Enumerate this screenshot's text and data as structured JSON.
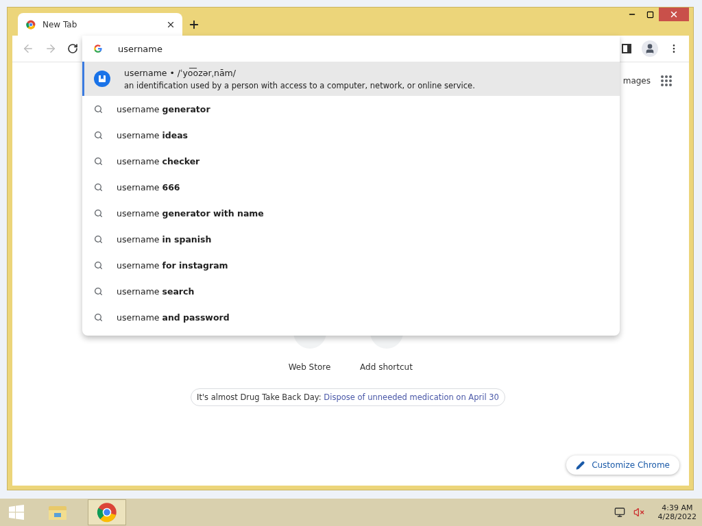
{
  "tabs": [
    {
      "title": "New Tab",
      "selected": true
    }
  ],
  "omnibox": {
    "value": "username"
  },
  "suggestions": [
    {
      "kind": "definition",
      "title": "username • /ˈyo͞ozərˌnām/",
      "description": "an identification used by a person with access to a computer, network, or online service.",
      "selected": true
    },
    {
      "kind": "search",
      "text": "username **generator**",
      "selected": false
    },
    {
      "kind": "search",
      "text": "username **ideas**",
      "selected": false
    },
    {
      "kind": "search",
      "text": "username **checker**",
      "selected": false
    },
    {
      "kind": "search",
      "text": "username **666**",
      "selected": false
    },
    {
      "kind": "search",
      "text": "username **generator with name**",
      "selected": false
    },
    {
      "kind": "search",
      "text": "username **in spanish**",
      "selected": false
    },
    {
      "kind": "search",
      "text": "username **for instagram**",
      "selected": false
    },
    {
      "kind": "search",
      "text": "username **search**",
      "selected": false
    },
    {
      "kind": "search",
      "text": "username **and password**",
      "selected": false
    }
  ],
  "page": {
    "images_link": "mages",
    "shortcuts": [
      {
        "label": "Web Store"
      },
      {
        "label": "Add shortcut"
      }
    ],
    "promo": {
      "text": "It's almost Drug Take Back Day:",
      "link": "Dispose of unneeded medication on April 30"
    },
    "customize": "Customize Chrome"
  },
  "taskbar": {
    "time": "4:39 AM",
    "date": "4/28/2022"
  }
}
